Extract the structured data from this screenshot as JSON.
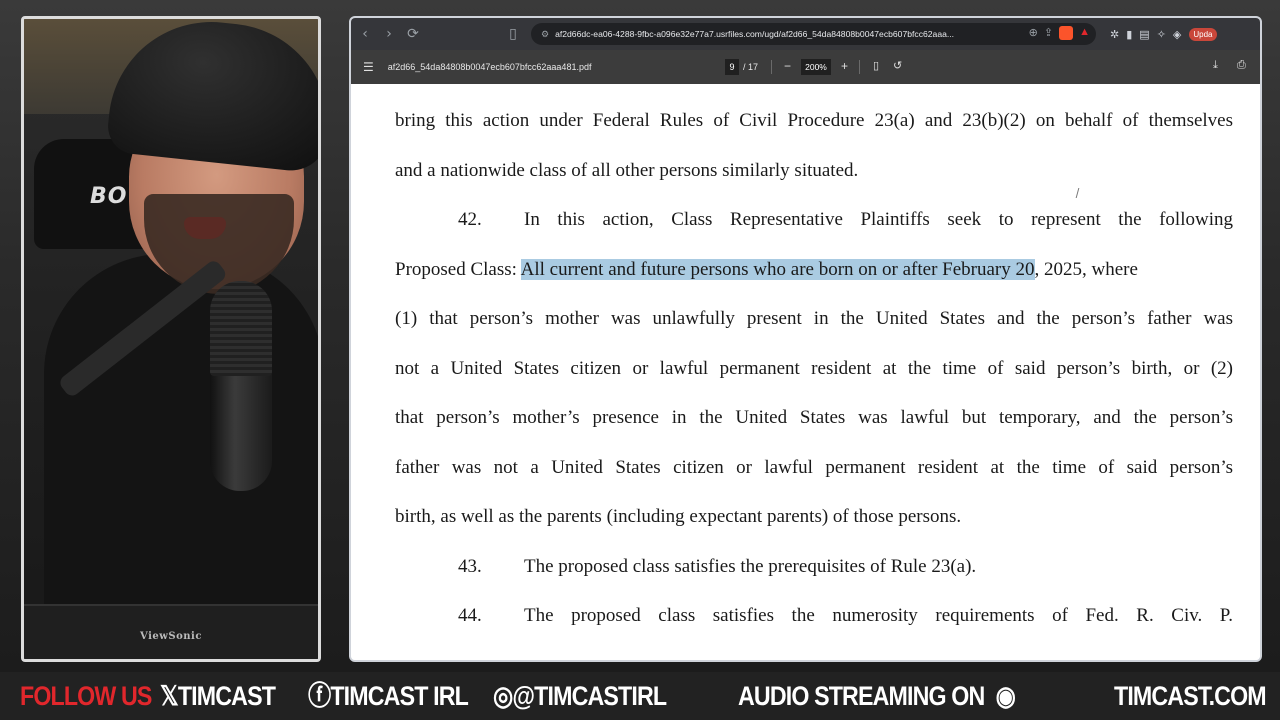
{
  "browser": {
    "url": "af2d66dc-ea06-4288-9fbc-a096e32e77a7.usrfiles.com/ugd/af2d66_54da84808b0047ecb607bfcc62aaa...",
    "update_label": "Upda"
  },
  "pdf_toolbar": {
    "filename": "af2d66_54da84808b0047ecb607bfcc62aaa481.pdf",
    "current_page": "9",
    "total_pages": "/ 17",
    "zoom": "200%"
  },
  "document": {
    "lines": [
      "bring this action under Federal Rules of Civil Procedure 23(a) and 23(b)(2) on behalf of themselves",
      "and a nationwide class of all other persons similarly situated."
    ],
    "para42_number": "42.",
    "para42_first": "In this action, Class Representative Plaintiffs seek to represent the following",
    "para42_prefix": "Proposed Class: ",
    "para42_highlight": "All current and future persons who are born on or after February 20",
    "para42_suffix": ", 2025, where",
    "para42_lines": [
      "(1) that person’s mother was unlawfully present in the United States and the person’s father was",
      "not a United States citizen or lawful permanent resident at the time of said person’s birth, or (2)",
      "that person’s mother’s presence in the United States was lawful but temporary, and the person’s",
      "father was not a United States citizen or lawful permanent resident at the time of said person’s",
      "birth, as well as the parents (including expectant parents) of those persons."
    ],
    "para43_number": "43.",
    "para43_text": "The proposed class satisfies the prerequisites of Rule 23(a).",
    "para44_number": "44.",
    "para44_text": "The proposed class satisfies the numerosity requirements of Fed. R. Civ. P."
  },
  "webcam": {
    "chair_text": "BO",
    "monitor_brand": "ViewSonic"
  },
  "banner": {
    "follow": "FOLLOW US",
    "x_handle": "TIMCAST",
    "facebook_handle": "TIMCAST IRL",
    "instagram_handle": "@TIMCASTIRL",
    "audio": "AUDIO STREAMING ON",
    "site": "TIMCAST.COM",
    "colors": {
      "follow": "#e1272c",
      "bg": "#222222"
    }
  }
}
